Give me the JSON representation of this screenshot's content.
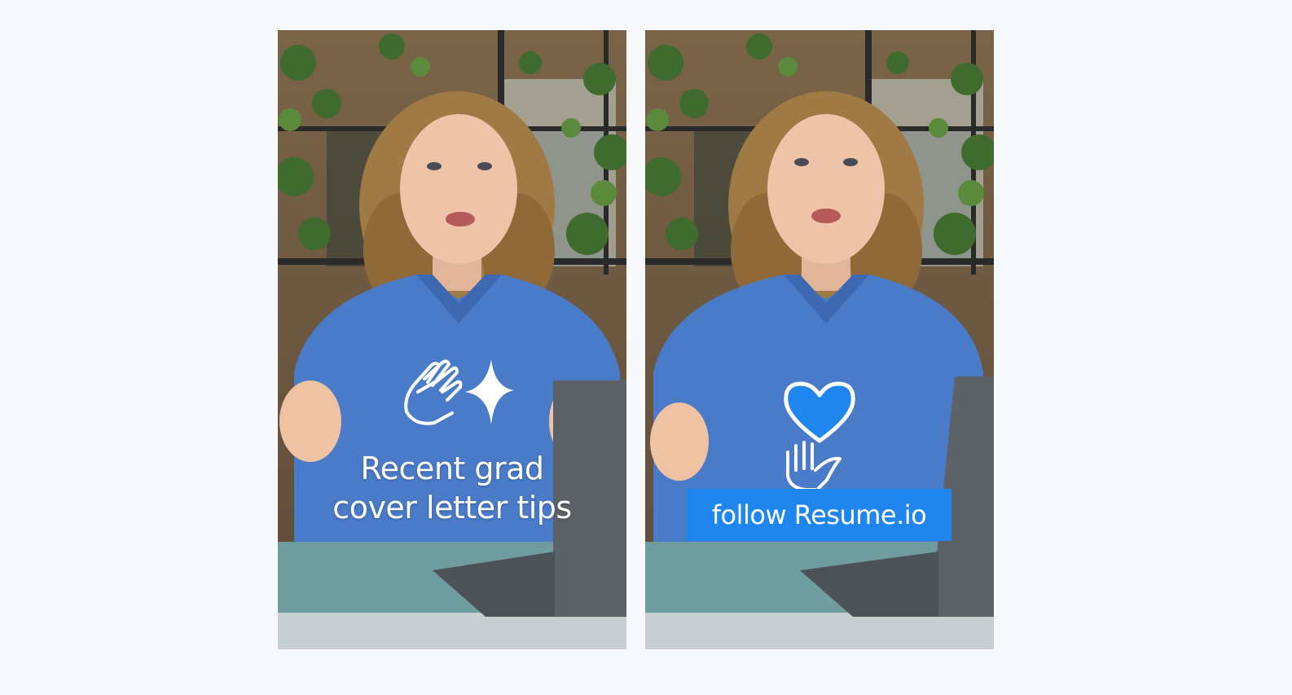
{
  "panels": [
    {
      "caption_lines": [
        "Recent grad",
        "cover letter tips"
      ],
      "sticker_icon": "clapping-hands-sparkle-icon"
    },
    {
      "cta_label": "follow Resume.io",
      "sticker_icon": "heart-in-hand-icon"
    }
  ],
  "colors": {
    "page_background": "#f7f8fc",
    "shirt_blue": "#4a7bc9",
    "cta_blue": "#1f86ef",
    "overlay_text": "#ffffff"
  }
}
